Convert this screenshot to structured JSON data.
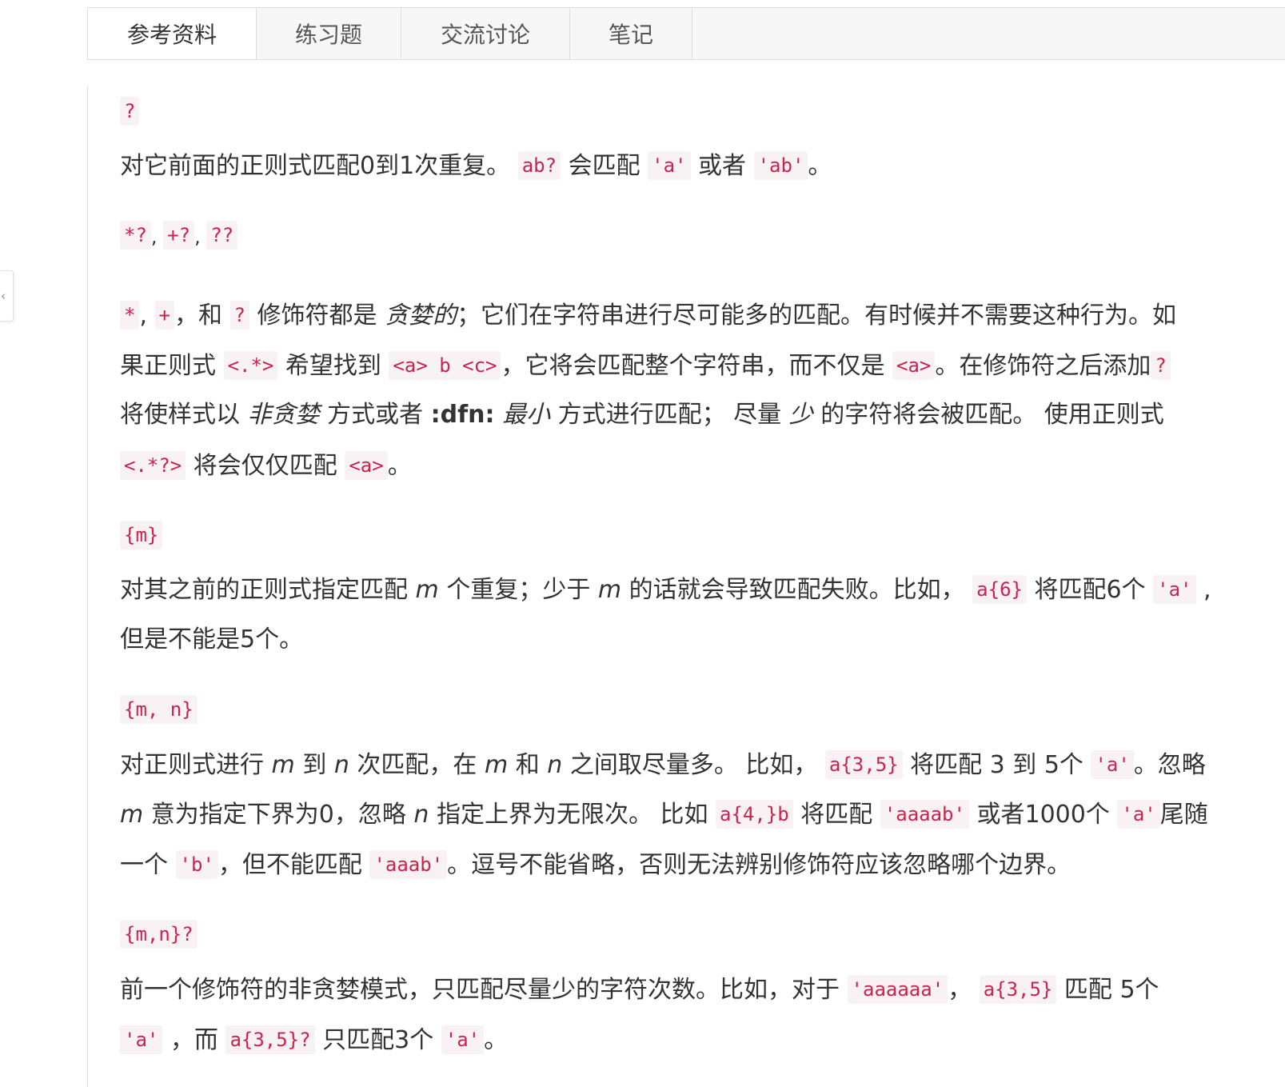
{
  "tabs": [
    {
      "label": "参考资料",
      "active": true
    },
    {
      "label": "练习题",
      "active": false
    },
    {
      "label": "交流讨论",
      "active": false
    },
    {
      "label": "笔记",
      "active": false
    }
  ],
  "side_handle": {
    "icon": "chevron-left-icon",
    "glyph": "‹"
  },
  "colors": {
    "code_text": "#c7254e",
    "code_bg": "#f9f2f4",
    "tab_bg": "#f7f7f7",
    "border": "#dddddd"
  },
  "sections": {
    "q": {
      "term": "?",
      "l1": {
        "t1": "对它前面的正则式匹配0到1次重复。 ",
        "c1": "ab?",
        "t2": " 会匹配 ",
        "c2": "'a'",
        "t3": " 或者 ",
        "c3": "'ab'",
        "t4": "。"
      }
    },
    "lazy": {
      "terms": {
        "c1": "*?",
        "sep1": ", ",
        "c2": "+?",
        "sep2": ", ",
        "c3": "??"
      },
      "l1": {
        "c1": "*",
        "t1": ", ",
        "c2": "+",
        "t2": "，和 ",
        "c3": "?",
        "t3": " 修饰符都是 ",
        "e1": "贪婪的",
        "t4": "；它们在字符串进行尽可能多的匹配。有时候并不需要这种行为。如"
      },
      "l2": {
        "t1": "果正则式 ",
        "c1": "<.*>",
        "t2": " 希望找到 ",
        "c2": "<a> b <c>",
        "t3": "，它将会匹配整个字符串，而不仅是 ",
        "c3": "<a>",
        "t4": "。在修饰符之后添加",
        "c4": "?"
      },
      "l3": {
        "t1": "将使样式以 ",
        "e1": "非贪婪",
        "t2": " 方式或者 ",
        "b1": ":dfn:",
        "t3": " ",
        "e2": "最小",
        "t4": " 方式进行匹配； 尽量 ",
        "e3": "少",
        "t5": " 的字符将会被匹配。 使用正则式"
      },
      "l4": {
        "c1": "<.*?>",
        "t1": " 将会仅仅匹配 ",
        "c2": "<a>",
        "t2": "。"
      }
    },
    "m": {
      "term": "{m}",
      "l1": {
        "t1": "对其之前的正则式指定匹配 ",
        "e1": "m",
        "t2": " 个重复；少于 ",
        "e2": "m",
        "t3": " 的话就会导致匹配失败。比如， ",
        "c1": "a{6}",
        "t4": " 将匹配6个 ",
        "c2": "'a'",
        "t5": " ,"
      },
      "l2": {
        "t1": "但是不能是5个。"
      }
    },
    "mn": {
      "term": "{m, n}",
      "l1": {
        "t1": "对正则式进行 ",
        "e1": "m",
        "t2": " 到 ",
        "e2": "n",
        "t3": " 次匹配，在 ",
        "e3": "m",
        "t4": " 和 ",
        "e4": "n",
        "t5": " 之间取尽量多。 比如， ",
        "c1": "a{3,5}",
        "t6": " 将匹配 3 到 5个 ",
        "c2": "'a'",
        "t7": "。忽略"
      },
      "l2": {
        "e1": "m",
        "t1": " 意为指定下界为0，忽略 ",
        "e2": "n",
        "t2": " 指定上界为无限次。 比如 ",
        "c1": "a{4,}b",
        "t3": " 将匹配 ",
        "c2": "'aaaab'",
        "t4": " 或者1000个 ",
        "c3": "'a'",
        "t5": "尾随"
      },
      "l3": {
        "t1": "一个 ",
        "c1": "'b'",
        "t2": "，但不能匹配 ",
        "c2": "'aaab'",
        "t3": "。逗号不能省略，否则无法辨别修饰符应该忽略哪个边界。"
      }
    },
    "mnq": {
      "term": "{m,n}?",
      "l1": {
        "t1": "前一个修饰符的非贪婪模式，只匹配尽量少的字符次数。比如，对于 ",
        "c1": "'aaaaaa'",
        "t2": "， ",
        "c2": "a{3,5}",
        "t3": " 匹配 5个"
      },
      "l2": {
        "c1": "'a'",
        "t1": " ，而 ",
        "c2": "a{3,5}?",
        "t2": " 只匹配3个 ",
        "c3": "'a'",
        "t3": "。"
      }
    }
  }
}
